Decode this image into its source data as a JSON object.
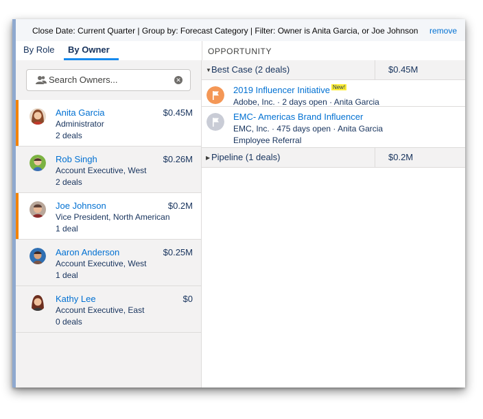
{
  "topbar": {
    "filter_text": "Close Date: Current Quarter  |  Group by: Forecast Category  |   Filter: Owner is Anita Garcia, or Joe Johnson",
    "remove_label": "remove"
  },
  "tabs": {
    "by_role": "By Role",
    "by_owner": "By Owner"
  },
  "opportunity_header": "OPPORTUNITY",
  "search": {
    "placeholder": "Search Owners..."
  },
  "owners": [
    {
      "name": "Anita Garcia",
      "title": "Administrator",
      "deals": "2 deals",
      "amount": "$0.45M",
      "selected": true
    },
    {
      "name": "Rob Singh",
      "title": "Account Executive, West",
      "deals": "2 deals",
      "amount": "$0.26M",
      "selected": false
    },
    {
      "name": "Joe Johnson",
      "title": "Vice President, North American",
      "deals": "1 deal",
      "amount": "$0.2M",
      "selected": true
    },
    {
      "name": "Aaron Anderson",
      "title": "Account Executive, West",
      "deals": "1 deal",
      "amount": "$0.25M",
      "selected": false
    },
    {
      "name": "Kathy Lee",
      "title": "Account Executive, East",
      "deals": "0 deals",
      "amount": "$0",
      "selected": false
    }
  ],
  "groups": [
    {
      "title": "Best Case (2 deals)",
      "amount": "$0.45M",
      "expanded": true
    },
    {
      "title": "Pipeline (1 deals)",
      "amount": "$0.2M",
      "expanded": false
    }
  ],
  "opportunities": [
    {
      "title": "2019 Influencer Initiative",
      "badge": "New!",
      "meta": "Adobe, Inc.  ·  2 days open  ·  Anita Garcia",
      "source": "",
      "flag_color": "#f49756",
      "icon": "flag-icon"
    },
    {
      "title": "EMC- Americas Brand Influencer",
      "badge": "",
      "meta": "EMC, Inc.  ·  475 days open  ·  Anita Garcia",
      "source": "Employee Referral",
      "flag_color": "#c9ccd6",
      "icon": "flag-icon"
    }
  ],
  "colors": {
    "accent_blue": "#1589ee",
    "selected_bar": "#f38303",
    "link": "#0070d2"
  }
}
